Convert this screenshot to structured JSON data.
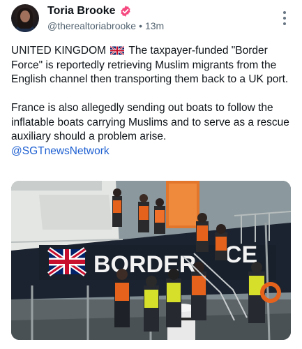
{
  "post": {
    "author": {
      "name": "Toria Brooke",
      "handle": "@therealtoriabrooke",
      "time": "13m",
      "separator": "•",
      "verified": true,
      "avatar_icon": "user-avatar"
    },
    "text_lines": [
      "UNITED KINGDOM",
      "The taxpayer-funded \"Border Force\" is reportedly retrieving Muslim migrants from the English channel then transporting them back to a UK port.",
      "France is also allegedly sending out boats to follow the inflatable boats carrying Muslims and to serve as a rescue auxiliary should a problem arise."
    ],
    "mention": "@SGTnewsNetwork",
    "flag_emoji_icon": "uk-flag-icon",
    "media": {
      "boat_sign_text": "BORDER FORCE",
      "boat_sign_visible": "BORDER",
      "boat_sign_partial": "CE"
    }
  },
  "colors": {
    "link": "#1d5fd1",
    "verified_badge": "#f5487f",
    "secondary_text": "#536471",
    "boat_hull": "#1c2330",
    "hi_vis": "#d6e02a",
    "orange_vest": "#e5621c"
  }
}
